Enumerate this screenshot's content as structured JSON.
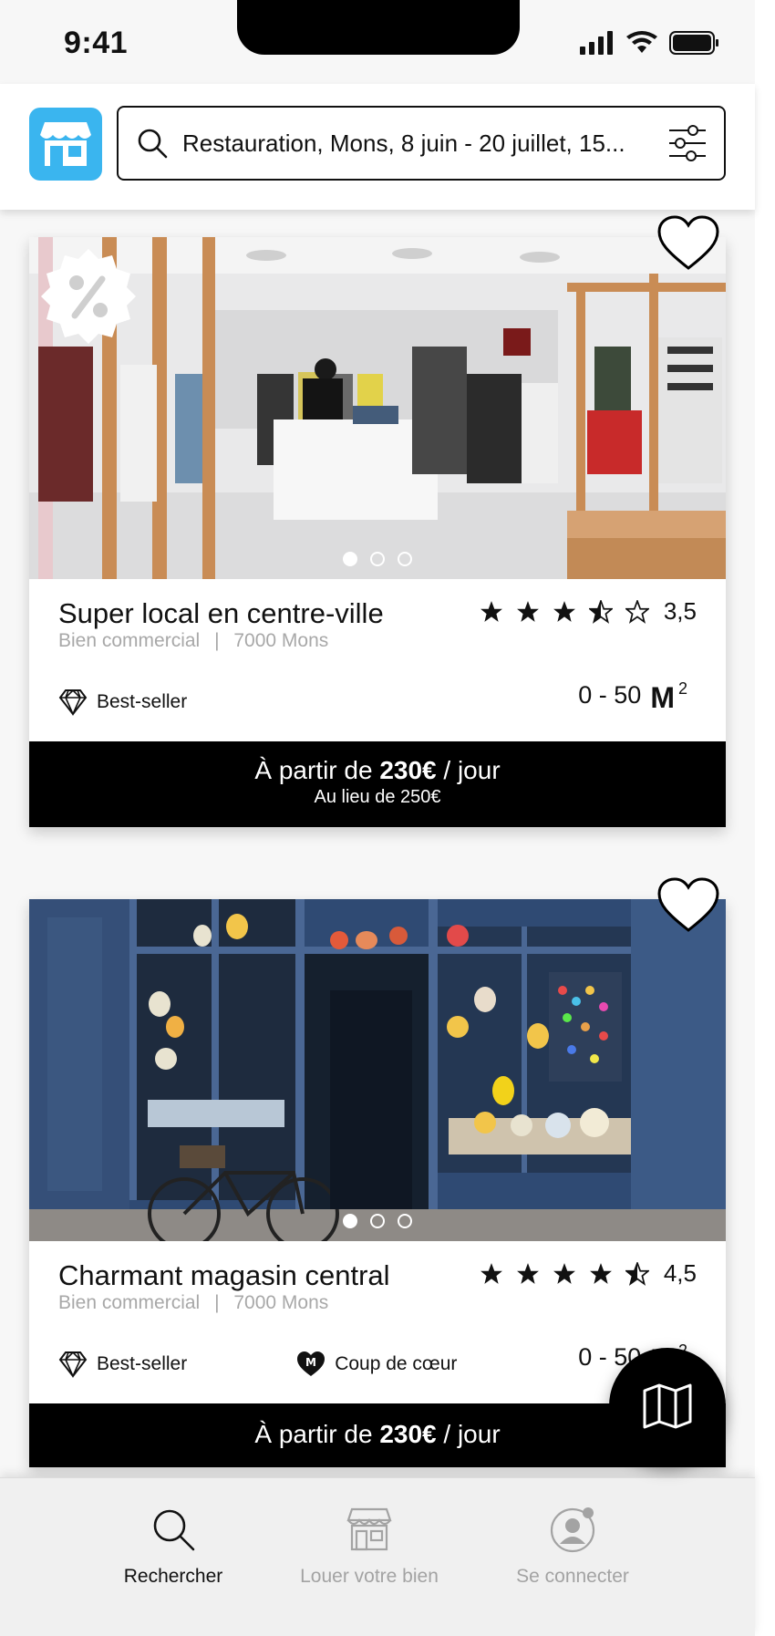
{
  "status_bar": {
    "time": "9:41"
  },
  "search": {
    "query": "Restauration, Mons, 8 juin - 20 juillet, 15..."
  },
  "listings": [
    {
      "title": "Super local en centre-ville",
      "type": "Bien commercial",
      "location": "7000 Mons",
      "rating": "3,5",
      "rating_value": 3.5,
      "tags": [
        {
          "label": "Best-seller",
          "icon": "diamond-icon"
        }
      ],
      "surface": "0 - 50",
      "surface_unit": "M",
      "surface_sup": "2",
      "price_prefix": "À partir de",
      "price": "230€",
      "price_suffix": "/ jour",
      "price_old": "Au lieu de 250€",
      "discount_badge": true,
      "carousel_dots": 3,
      "carousel_active": 1
    },
    {
      "title": "Charmant magasin central",
      "type": "Bien commercial",
      "location": "7000 Mons",
      "rating": "4,5",
      "rating_value": 4.5,
      "tags": [
        {
          "label": "Best-seller",
          "icon": "diamond-icon"
        },
        {
          "label": "Coup de cœur",
          "icon": "heart-m-icon"
        }
      ],
      "surface": "0 - 50",
      "surface_unit": "M",
      "surface_sup": "2",
      "price_prefix": "À partir de",
      "price": "230€",
      "price_suffix": "/ jour",
      "carousel_dots": 3,
      "carousel_active": 1
    }
  ],
  "separator": "|",
  "nav": {
    "items": [
      {
        "label": "Rechercher",
        "icon": "search-icon",
        "active": true
      },
      {
        "label": "Louer votre bien",
        "icon": "store-icon",
        "active": false
      },
      {
        "label": "Se connecter",
        "icon": "user-icon",
        "active": false
      }
    ]
  },
  "colors": {
    "brand": "#3ab5ef",
    "price_bar": "#000000",
    "muted": "#a8a8a8"
  }
}
